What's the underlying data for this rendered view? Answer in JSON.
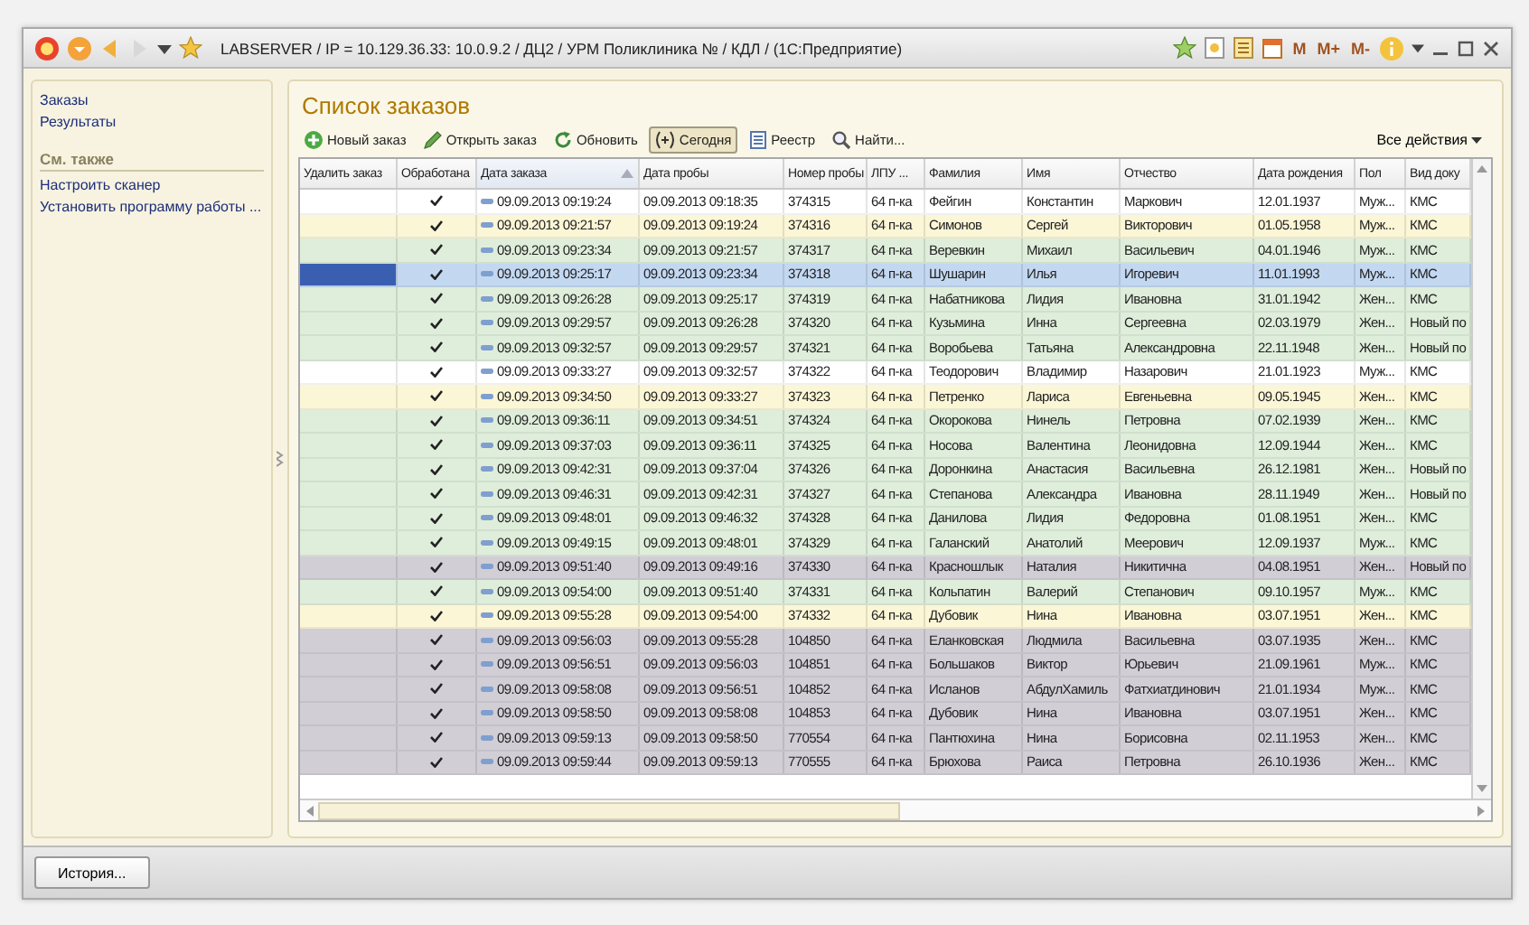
{
  "window": {
    "title": "LABSERVER / IP = 10.129.36.33: 10.0.9.2 / ДЦ2 / УРМ Поликлиника №    / КДЛ / (1С:Предприятие)",
    "memory_buttons": [
      "M",
      "M+",
      "M-"
    ]
  },
  "sidebar": {
    "items": [
      {
        "label": "Заказы"
      },
      {
        "label": "Результаты"
      }
    ],
    "see_also_heading": "См. также",
    "see_also": [
      {
        "label": "Настроить сканер"
      },
      {
        "label": "Установить программу работы ..."
      }
    ]
  },
  "form": {
    "title": "Список заказов",
    "toolbar": [
      {
        "kind": "new",
        "label": "Новый заказ",
        "pressed": false
      },
      {
        "kind": "edit",
        "label": "Открыть заказ",
        "pressed": false
      },
      {
        "kind": "refresh",
        "label": "Обновить",
        "pressed": false
      },
      {
        "kind": "today",
        "label": "Сегодня",
        "pressed": true
      },
      {
        "kind": "registry",
        "label": "Реестр",
        "pressed": false
      },
      {
        "kind": "find",
        "label": "Найти...",
        "pressed": false
      }
    ],
    "all_actions": "Все действия"
  },
  "table": {
    "columns": [
      {
        "label": "Удалить заказ",
        "sorted": false
      },
      {
        "label": "Обработана",
        "sorted": false
      },
      {
        "label": "Дата заказа",
        "sorted": true
      },
      {
        "label": "Дата пробы",
        "sorted": false
      },
      {
        "label": "Номер пробы",
        "sorted": false
      },
      {
        "label": "ЛПУ ...",
        "sorted": false
      },
      {
        "label": "Фамилия",
        "sorted": false
      },
      {
        "label": "Имя",
        "sorted": false
      },
      {
        "label": "Отчество",
        "sorted": false
      },
      {
        "label": "Дата рождения",
        "sorted": false
      },
      {
        "label": "Пол",
        "sorted": false
      },
      {
        "label": "Вид доку",
        "sorted": false
      }
    ],
    "rows": [
      {
        "processed": true,
        "order_date": "09.09.2013 09:19:24",
        "sample_date": "09.09.2013 09:18:35",
        "sample_no": "374315",
        "lpu": "64 п-ка",
        "surname": "Фейгин",
        "name": "Константин",
        "patronymic": "Маркович",
        "birth": "12.01.1937",
        "sex": "Муж...",
        "doc": "КМС",
        "color": "#ffffff",
        "selected": false
      },
      {
        "processed": true,
        "order_date": "09.09.2013 09:21:57",
        "sample_date": "09.09.2013 09:19:24",
        "sample_no": "374316",
        "lpu": "64 п-ка",
        "surname": "Симонов",
        "name": "Сергей",
        "patronymic": "Викторович",
        "birth": "01.05.1958",
        "sex": "Муж...",
        "doc": "КМС",
        "color": "#fbf6d6",
        "selected": false
      },
      {
        "processed": true,
        "order_date": "09.09.2013 09:23:34",
        "sample_date": "09.09.2013 09:21:57",
        "sample_no": "374317",
        "lpu": "64 п-ка",
        "surname": "Веревкин",
        "name": "Михаил",
        "patronymic": "Васильевич",
        "birth": "04.01.1946",
        "sex": "Муж...",
        "doc": "КМС",
        "color": "#dfeddb",
        "selected": false
      },
      {
        "processed": true,
        "order_date": "09.09.2013 09:25:17",
        "sample_date": "09.09.2013 09:23:34",
        "sample_no": "374318",
        "lpu": "64 п-ка",
        "surname": "Шушарин",
        "name": "Илья",
        "patronymic": "Игоревич",
        "birth": "11.01.1993",
        "sex": "Муж...",
        "doc": "КМС",
        "color": "#dfeddb",
        "selected": true
      },
      {
        "processed": true,
        "order_date": "09.09.2013 09:26:28",
        "sample_date": "09.09.2013 09:25:17",
        "sample_no": "374319",
        "lpu": "64 п-ка",
        "surname": "Набатникова",
        "name": "Лидия",
        "patronymic": "Ивановна",
        "birth": "31.01.1942",
        "sex": "Жен...",
        "doc": "КМС",
        "color": "#dfeddb",
        "selected": false
      },
      {
        "processed": true,
        "order_date": "09.09.2013 09:29:57",
        "sample_date": "09.09.2013 09:26:28",
        "sample_no": "374320",
        "lpu": "64 п-ка",
        "surname": "Кузьмина",
        "name": "Инна",
        "patronymic": "Сергеевна",
        "birth": "02.03.1979",
        "sex": "Жен...",
        "doc": "Новый по",
        "color": "#dfeddb",
        "selected": false
      },
      {
        "processed": true,
        "order_date": "09.09.2013 09:32:57",
        "sample_date": "09.09.2013 09:29:57",
        "sample_no": "374321",
        "lpu": "64 п-ка",
        "surname": "Воробьева",
        "name": "Татьяна",
        "patronymic": "Александровна",
        "birth": "22.11.1948",
        "sex": "Жен...",
        "doc": "Новый по",
        "color": "#dfeddb",
        "selected": false
      },
      {
        "processed": true,
        "order_date": "09.09.2013 09:33:27",
        "sample_date": "09.09.2013 09:32:57",
        "sample_no": "374322",
        "lpu": "64 п-ка",
        "surname": "Теодорович",
        "name": "Владимир",
        "patronymic": "Назарович",
        "birth": "21.01.1923",
        "sex": "Муж...",
        "doc": "КМС",
        "color": "#ffffff",
        "selected": false
      },
      {
        "processed": true,
        "order_date": "09.09.2013 09:34:50",
        "sample_date": "09.09.2013 09:33:27",
        "sample_no": "374323",
        "lpu": "64 п-ка",
        "surname": "Петренко",
        "name": "Лариса",
        "patronymic": "Евгеньевна",
        "birth": "09.05.1945",
        "sex": "Жен...",
        "doc": "КМС",
        "color": "#fbf6d6",
        "selected": false
      },
      {
        "processed": true,
        "order_date": "09.09.2013 09:36:11",
        "sample_date": "09.09.2013 09:34:51",
        "sample_no": "374324",
        "lpu": "64 п-ка",
        "surname": "Окорокова",
        "name": "Нинель",
        "patronymic": "Петровна",
        "birth": "07.02.1939",
        "sex": "Жен...",
        "doc": "КМС",
        "color": "#dfeddb",
        "selected": false
      },
      {
        "processed": true,
        "order_date": "09.09.2013 09:37:03",
        "sample_date": "09.09.2013 09:36:11",
        "sample_no": "374325",
        "lpu": "64 п-ка",
        "surname": "Носова",
        "name": "Валентина",
        "patronymic": "Леонидовна",
        "birth": "12.09.1944",
        "sex": "Жен...",
        "doc": "КМС",
        "color": "#dfeddb",
        "selected": false
      },
      {
        "processed": true,
        "order_date": "09.09.2013 09:42:31",
        "sample_date": "09.09.2013 09:37:04",
        "sample_no": "374326",
        "lpu": "64 п-ка",
        "surname": "Доронкина",
        "name": "Анастасия",
        "patronymic": "Васильевна",
        "birth": "26.12.1981",
        "sex": "Жен...",
        "doc": "Новый по",
        "color": "#dfeddb",
        "selected": false
      },
      {
        "processed": true,
        "order_date": "09.09.2013 09:46:31",
        "sample_date": "09.09.2013 09:42:31",
        "sample_no": "374327",
        "lpu": "64 п-ка",
        "surname": "Степанова",
        "name": "Александра",
        "patronymic": "Ивановна",
        "birth": "28.11.1949",
        "sex": "Жен...",
        "doc": "Новый по",
        "color": "#dfeddb",
        "selected": false
      },
      {
        "processed": true,
        "order_date": "09.09.2013 09:48:01",
        "sample_date": "09.09.2013 09:46:32",
        "sample_no": "374328",
        "lpu": "64 п-ка",
        "surname": "Данилова",
        "name": "Лидия",
        "patronymic": "Федоровна",
        "birth": "01.08.1951",
        "sex": "Жен...",
        "doc": "КМС",
        "color": "#dfeddb",
        "selected": false
      },
      {
        "processed": true,
        "order_date": "09.09.2013 09:49:15",
        "sample_date": "09.09.2013 09:48:01",
        "sample_no": "374329",
        "lpu": "64 п-ка",
        "surname": "Галанский",
        "name": "Анатолий",
        "patronymic": "Меерович",
        "birth": "12.09.1937",
        "sex": "Муж...",
        "doc": "КМС",
        "color": "#dfeddb",
        "selected": false
      },
      {
        "processed": true,
        "order_date": "09.09.2013 09:51:40",
        "sample_date": "09.09.2013 09:49:16",
        "sample_no": "374330",
        "lpu": "64 п-ка",
        "surname": "Красношлык",
        "name": "Наталия",
        "patronymic": "Никитична",
        "birth": "04.08.1951",
        "sex": "Жен...",
        "doc": "Новый по",
        "color": "#d2ced6",
        "selected": false
      },
      {
        "processed": true,
        "order_date": "09.09.2013 09:54:00",
        "sample_date": "09.09.2013 09:51:40",
        "sample_no": "374331",
        "lpu": "64 п-ка",
        "surname": "Кольпатин",
        "name": "Валерий",
        "patronymic": "Степанович",
        "birth": "09.10.1957",
        "sex": "Муж...",
        "doc": "КМС",
        "color": "#dfeddb",
        "selected": false
      },
      {
        "processed": true,
        "order_date": "09.09.2013 09:55:28",
        "sample_date": "09.09.2013 09:54:00",
        "sample_no": "374332",
        "lpu": "64 п-ка",
        "surname": "Дубовик",
        "name": "Нина",
        "patronymic": "Ивановна",
        "birth": "03.07.1951",
        "sex": "Жен...",
        "doc": "КМС",
        "color": "#fbf6d6",
        "selected": false
      },
      {
        "processed": true,
        "order_date": "09.09.2013 09:56:03",
        "sample_date": "09.09.2013 09:55:28",
        "sample_no": "104850",
        "lpu": "64 п-ка",
        "surname": "Еланковская",
        "name": "Людмила",
        "patronymic": "Васильевна",
        "birth": "03.07.1935",
        "sex": "Жен...",
        "doc": "КМС",
        "color": "#d2ced6",
        "selected": false
      },
      {
        "processed": true,
        "order_date": "09.09.2013 09:56:51",
        "sample_date": "09.09.2013 09:56:03",
        "sample_no": "104851",
        "lpu": "64 п-ка",
        "surname": "Большаков",
        "name": "Виктор",
        "patronymic": "Юрьевич",
        "birth": "21.09.1961",
        "sex": "Муж...",
        "doc": "КМС",
        "color": "#d2ced6",
        "selected": false
      },
      {
        "processed": true,
        "order_date": "09.09.2013 09:58:08",
        "sample_date": "09.09.2013 09:56:51",
        "sample_no": "104852",
        "lpu": "64 п-ка",
        "surname": "Исланов",
        "name": "АбдулХамиль",
        "patronymic": "Фатхиатдинович",
        "birth": "21.01.1934",
        "sex": "Муж...",
        "doc": "КМС",
        "color": "#d2ced6",
        "selected": false
      },
      {
        "processed": true,
        "order_date": "09.09.2013 09:58:50",
        "sample_date": "09.09.2013 09:58:08",
        "sample_no": "104853",
        "lpu": "64 п-ка",
        "surname": "Дубовик",
        "name": "Нина",
        "patronymic": "Ивановна",
        "birth": "03.07.1951",
        "sex": "Жен...",
        "doc": "КМС",
        "color": "#d2ced6",
        "selected": false
      },
      {
        "processed": true,
        "order_date": "09.09.2013 09:59:13",
        "sample_date": "09.09.2013 09:58:50",
        "sample_no": "770554",
        "lpu": "64 п-ка",
        "surname": "Пантюхина",
        "name": "Нина",
        "patronymic": "Борисовна",
        "birth": "02.11.1953",
        "sex": "Жен...",
        "doc": "КМС",
        "color": "#d2ced6",
        "selected": false
      },
      {
        "processed": true,
        "order_date": "09.09.2013 09:59:44",
        "sample_date": "09.09.2013 09:59:13",
        "sample_no": "770555",
        "lpu": "64 п-ка",
        "surname": "Брюхова",
        "name": "Раиса",
        "patronymic": "Петровна",
        "birth": "26.10.1936",
        "sex": "Жен...",
        "doc": "КМС",
        "color": "#d2ced6",
        "selected": false
      }
    ]
  },
  "bottom_bar": {
    "history_button": "История..."
  }
}
